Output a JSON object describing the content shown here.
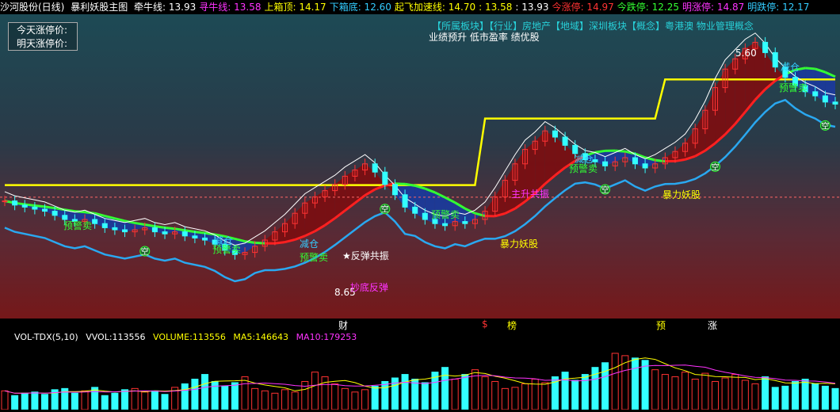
{
  "header": {
    "stock_name": "沙河股份(日线)",
    "indicator_name": "暴利妖股主图",
    "items": [
      {
        "label": "牵牛线:",
        "value": "13.93",
        "color": "#ffffff"
      },
      {
        "label": "寻牛线:",
        "value": "13.58",
        "color": "#ff33ff"
      },
      {
        "label": "上箱顶:",
        "value": "14.17",
        "color": "#ffff00"
      },
      {
        "label": "下箱底:",
        "value": "12.60",
        "color": "#33ccff"
      },
      {
        "label": "起飞加速线:",
        "value": "14.70",
        "color": "#ffff00"
      },
      {
        "label": ":",
        "value": "13.58",
        "color": "#ffff00"
      },
      {
        "label": ":",
        "value": "13.93",
        "color": "#ffffff"
      },
      {
        "label": "今涨停:",
        "value": "14.97",
        "color": "#ff3333"
      },
      {
        "label": "今跌停:",
        "value": "12.25",
        "color": "#33ff33"
      },
      {
        "label": "明涨停:",
        "value": "14.87",
        "color": "#ff33ff"
      },
      {
        "label": "明跌停:",
        "value": "12.17",
        "color": "#33ccff"
      }
    ]
  },
  "legend": {
    "today_label": "今天涨停价:",
    "tomorrow_label": "明天涨停价:"
  },
  "sector": {
    "line1": "【所属板块】【行业】房地产【地域】深圳板块【概念】粤港澳 物业管理概念",
    "line2": "业绩预升 低市盈率 绩优股"
  },
  "annotations": {
    "low_value": "8.65",
    "high_value": "5.60",
    "resonance": "★反弹共振",
    "resonance2": "主升共振",
    "monster1": "暴力妖股",
    "monster2": "暴力妖股",
    "reduce": "减仓",
    "warn_sell": "预警卖",
    "empty": "空",
    "bottom_rebound": "抄底反弹"
  },
  "date_markers": [
    {
      "label": "财",
      "color": "#ffffff"
    },
    {
      "label": "$",
      "color": "#ff3333"
    },
    {
      "label": "榜",
      "color": "#ffff00"
    },
    {
      "label": "预",
      "color": "#ffff00"
    },
    {
      "label": "涨",
      "color": "#ffffff"
    }
  ],
  "volume": {
    "indicator": "VOL-TDX(5,10)",
    "vvol_label": "VVOL:",
    "vvol_value": "113556",
    "volume_label": "VOLUME:",
    "volume_value": "113556",
    "ma5_label": "MA5:",
    "ma5_value": "146643",
    "ma10_label": "MA10:",
    "ma10_value": "179253"
  },
  "chart_data": {
    "type": "candlestick",
    "series_names": [
      "牵牛线",
      "寻牛线",
      "上箱顶",
      "下箱底",
      "起飞加速线"
    ],
    "close_prices": [
      13.4,
      13.2,
      13.1,
      13.0,
      12.9,
      12.7,
      12.5,
      12.4,
      12.5,
      12.3,
      12.1,
      12.0,
      11.9,
      12.0,
      12.1,
      11.9,
      11.8,
      11.9,
      11.7,
      11.6,
      11.5,
      11.3,
      11.0,
      10.8,
      10.9,
      11.2,
      11.5,
      11.9,
      12.3,
      12.8,
      13.3,
      13.6,
      13.9,
      14.2,
      14.6,
      14.9,
      15.2,
      14.8,
      14.2,
      13.7,
      13.1,
      12.8,
      12.5,
      12.3,
      12.2,
      12.4,
      12.3,
      12.5,
      12.9,
      13.6,
      14.4,
      15.2,
      15.9,
      16.3,
      16.8,
      16.5,
      16.1,
      15.7,
      15.4,
      15.3,
      15.1,
      15.3,
      15.5,
      15.2,
      15.0,
      15.2,
      15.5,
      15.8,
      16.2,
      16.9,
      17.8,
      18.9,
      19.8,
      20.3,
      20.8,
      21.1,
      20.6,
      19.9,
      19.4,
      19.0,
      18.7,
      18.5,
      18.2,
      18.1
    ],
    "volume": [
      80,
      60,
      70,
      75,
      65,
      85,
      90,
      70,
      80,
      95,
      60,
      70,
      85,
      90,
      75,
      80,
      65,
      95,
      110,
      130,
      150,
      120,
      100,
      115,
      140,
      90,
      80,
      70,
      85,
      75,
      120,
      160,
      140,
      110,
      90,
      75,
      85,
      100,
      120,
      135,
      150,
      130,
      115,
      160,
      180,
      130,
      150,
      170,
      140,
      120,
      90,
      95,
      110,
      130,
      115,
      140,
      160,
      125,
      150,
      180,
      200,
      240,
      230,
      220,
      210,
      170,
      150,
      140,
      160,
      130,
      155,
      120,
      135,
      150,
      125,
      110,
      140,
      95,
      100,
      120,
      130,
      110,
      100,
      90
    ],
    "ylim": [
      8.0,
      22.0
    ]
  },
  "colors": {
    "up": "#ff3333",
    "down": "#33ffff",
    "cloud_blue": "#1b3a9a",
    "cloud_red": "#7a0f12",
    "yellow": "#ffff00",
    "green": "#33ff33",
    "red_line": "#ff2020",
    "cyan_line": "#2aa8f0",
    "magenta": "#ff33ff"
  }
}
